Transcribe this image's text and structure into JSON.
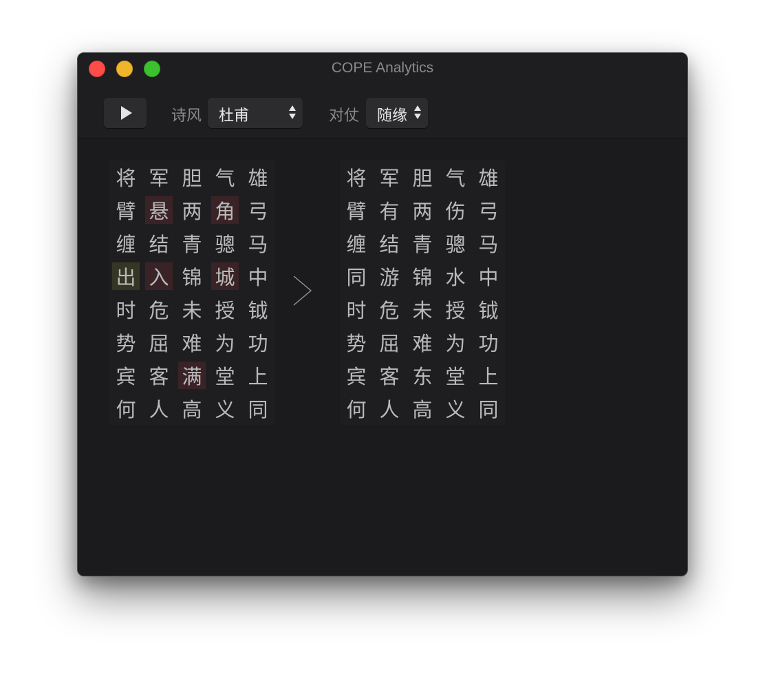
{
  "window": {
    "title": "COPE Analytics"
  },
  "toolbar": {
    "play_icon": "play-icon",
    "style_label": "诗风",
    "style_value": "杜甫",
    "parallel_label": "对仗",
    "parallel_value": "随缘"
  },
  "colors": {
    "window_bg": "#1b1b1d",
    "text": "#b9b9bb",
    "changed_highlight": "#3a2326",
    "changed_alt_highlight": "#363624",
    "close": "#fe4c48",
    "minimize": "#f0b52a",
    "zoom": "#3cc02e"
  },
  "original_poem": [
    [
      {
        "c": "将"
      },
      {
        "c": "军"
      },
      {
        "c": "胆"
      },
      {
        "c": "气"
      },
      {
        "c": "雄"
      }
    ],
    [
      {
        "c": "臂"
      },
      {
        "c": "悬",
        "h": "changed"
      },
      {
        "c": "两"
      },
      {
        "c": "角",
        "h": "changed"
      },
      {
        "c": "弓"
      }
    ],
    [
      {
        "c": "缠"
      },
      {
        "c": "结"
      },
      {
        "c": "青"
      },
      {
        "c": "骢"
      },
      {
        "c": "马"
      }
    ],
    [
      {
        "c": "出",
        "h": "changed-alt"
      },
      {
        "c": "入",
        "h": "changed"
      },
      {
        "c": "锦"
      },
      {
        "c": "城",
        "h": "changed"
      },
      {
        "c": "中"
      }
    ],
    [
      {
        "c": "时"
      },
      {
        "c": "危"
      },
      {
        "c": "未"
      },
      {
        "c": "授"
      },
      {
        "c": "钺"
      }
    ],
    [
      {
        "c": "势"
      },
      {
        "c": "屈"
      },
      {
        "c": "难"
      },
      {
        "c": "为"
      },
      {
        "c": "功"
      }
    ],
    [
      {
        "c": "宾"
      },
      {
        "c": "客"
      },
      {
        "c": "满",
        "h": "changed"
      },
      {
        "c": "堂"
      },
      {
        "c": "上"
      }
    ],
    [
      {
        "c": "何"
      },
      {
        "c": "人"
      },
      {
        "c": "高"
      },
      {
        "c": "义"
      },
      {
        "c": "同"
      }
    ]
  ],
  "result_poem": [
    [
      {
        "c": "将"
      },
      {
        "c": "军"
      },
      {
        "c": "胆"
      },
      {
        "c": "气"
      },
      {
        "c": "雄"
      }
    ],
    [
      {
        "c": "臂"
      },
      {
        "c": "有"
      },
      {
        "c": "两"
      },
      {
        "c": "伤"
      },
      {
        "c": "弓"
      }
    ],
    [
      {
        "c": "缠"
      },
      {
        "c": "结"
      },
      {
        "c": "青"
      },
      {
        "c": "骢"
      },
      {
        "c": "马"
      }
    ],
    [
      {
        "c": "同"
      },
      {
        "c": "游"
      },
      {
        "c": "锦"
      },
      {
        "c": "水"
      },
      {
        "c": "中"
      }
    ],
    [
      {
        "c": "时"
      },
      {
        "c": "危"
      },
      {
        "c": "未"
      },
      {
        "c": "授"
      },
      {
        "c": "钺"
      }
    ],
    [
      {
        "c": "势"
      },
      {
        "c": "屈"
      },
      {
        "c": "难"
      },
      {
        "c": "为"
      },
      {
        "c": "功"
      }
    ],
    [
      {
        "c": "宾"
      },
      {
        "c": "客"
      },
      {
        "c": "东"
      },
      {
        "c": "堂"
      },
      {
        "c": "上"
      }
    ],
    [
      {
        "c": "何"
      },
      {
        "c": "人"
      },
      {
        "c": "高"
      },
      {
        "c": "义"
      },
      {
        "c": "同"
      }
    ]
  ],
  "transform_icon": "chevron-right-icon"
}
